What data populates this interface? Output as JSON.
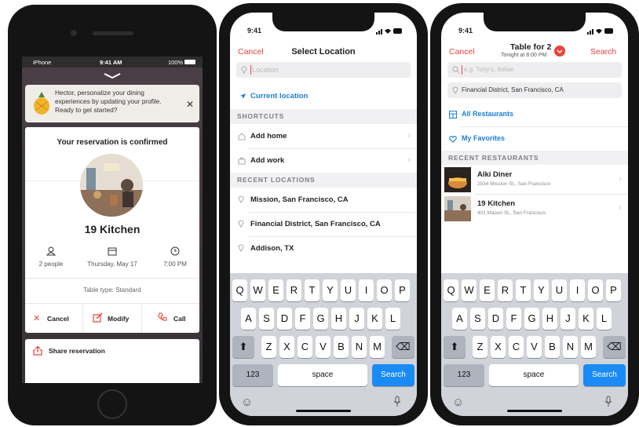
{
  "phone1": {
    "status": {
      "carrier": "iPhone",
      "time": "9:41 AM",
      "battery": "100%"
    },
    "banner": {
      "text": "Hector, personalize your dining experiences by updating your profile. Ready to get started?"
    },
    "card_title": "Your reservation is confirmed",
    "restaurant_name": "19 Kitchen",
    "details": [
      {
        "icon": "person-icon",
        "label": "2 people"
      },
      {
        "icon": "calendar-icon",
        "label": "Thursday, May 17"
      },
      {
        "icon": "clock-icon",
        "label": "7:00 PM"
      }
    ],
    "table_type": "Table type: Standard",
    "actions": {
      "cancel": "Cancel",
      "modify": "Modify",
      "call": "Call"
    },
    "share_label": "Share reservation"
  },
  "phone2": {
    "time": "9:41",
    "nav": {
      "cancel": "Cancel",
      "title": "Select Location"
    },
    "search_placeholder": "Location",
    "current_location": "Current location",
    "shortcuts_header": "SHORTCUTS",
    "shortcuts": [
      {
        "icon": "home-icon",
        "label": "Add home"
      },
      {
        "icon": "briefcase-icon",
        "label": "Add work"
      }
    ],
    "recent_header": "RECENT LOCATIONS",
    "recent": [
      "Mission, San Francisco, CA",
      "Financial District, San Francisco, CA",
      "Addison, TX"
    ],
    "keyboard": {
      "row1": [
        "Q",
        "W",
        "E",
        "R",
        "T",
        "Y",
        "U",
        "I",
        "O",
        "P"
      ],
      "row2": [
        "A",
        "S",
        "D",
        "F",
        "G",
        "H",
        "J",
        "K",
        "L"
      ],
      "row3": [
        "Z",
        "X",
        "C",
        "V",
        "B",
        "N",
        "M"
      ],
      "num": "123",
      "space": "space",
      "search": "Search"
    }
  },
  "phone3": {
    "time": "9:41",
    "nav": {
      "cancel": "Cancel",
      "title": "Table for 2",
      "subtitle": "Tonight at 8:00 PM",
      "search": "Search"
    },
    "search_placeholder": "e.g. Tony's, Italian",
    "location_value": "Financial District, San Francisco, CA",
    "links": [
      {
        "icon": "grid-icon",
        "label": "All Restaurants"
      },
      {
        "icon": "heart-icon",
        "label": "My Favorites"
      }
    ],
    "recent_header": "RECENT RESTAURANTS",
    "restaurants": [
      {
        "name": "Alki Diner",
        "address": "2534 Mission St., San Francisco"
      },
      {
        "name": "19 Kitchen",
        "address": "401 Mason St., San Francisco"
      }
    ],
    "keyboard": {
      "row1": [
        "Q",
        "W",
        "E",
        "R",
        "T",
        "Y",
        "U",
        "I",
        "O",
        "P"
      ],
      "row2": [
        "A",
        "S",
        "D",
        "F",
        "G",
        "H",
        "J",
        "K",
        "L"
      ],
      "row3": [
        "Z",
        "X",
        "C",
        "V",
        "B",
        "N",
        "M"
      ],
      "num": "123",
      "space": "space",
      "search": "Search"
    }
  },
  "colors": {
    "accent_red": "#e8443a",
    "accent_blue": "#1a80d6",
    "key_blue": "#1a8af5",
    "banner_bg": "#f0ede9"
  }
}
